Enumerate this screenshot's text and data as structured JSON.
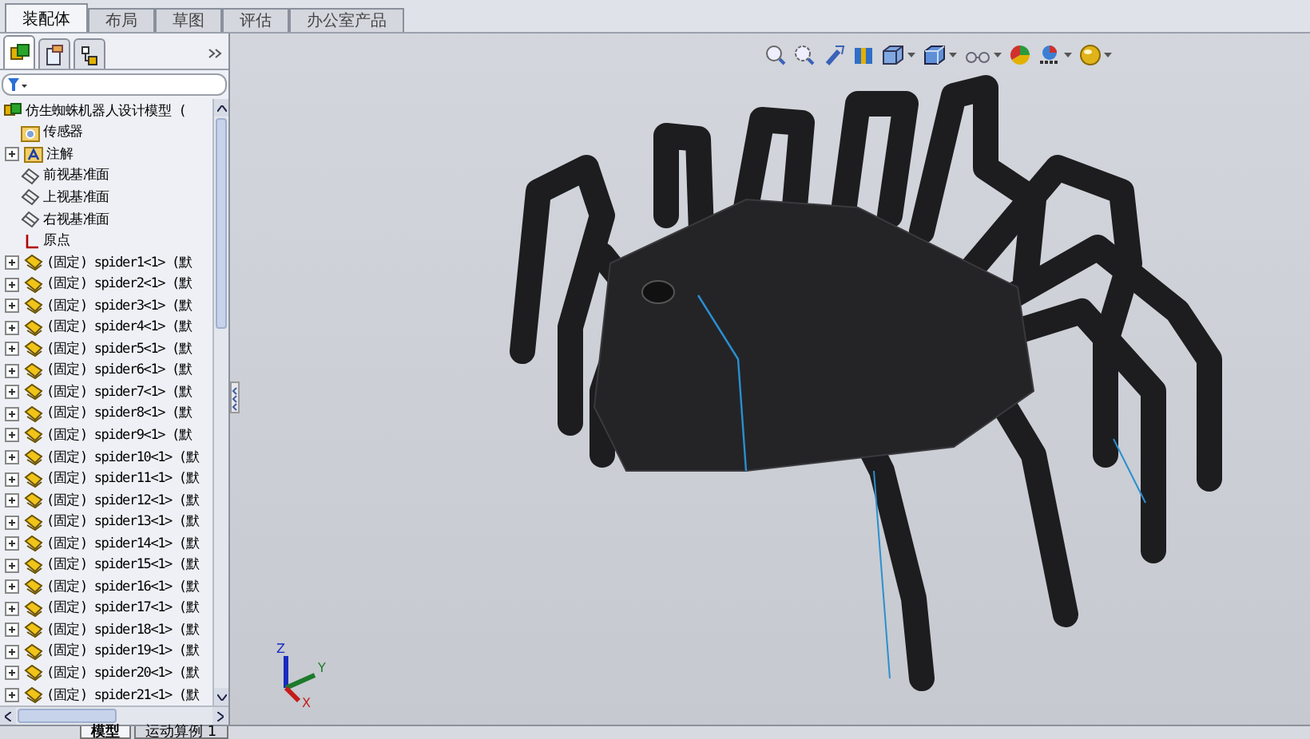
{
  "command_tabs": [
    {
      "label": "装配体",
      "selected": true
    },
    {
      "label": "布局",
      "selected": false
    },
    {
      "label": "草图",
      "selected": false
    },
    {
      "label": "评估",
      "selected": false
    },
    {
      "label": "办公室产品",
      "selected": false
    }
  ],
  "manager_tabs": [
    {
      "kind": "tree",
      "selected": true
    },
    {
      "kind": "property",
      "selected": false
    },
    {
      "kind": "config",
      "selected": false
    }
  ],
  "tree": [
    {
      "kind": "assembly",
      "label": "仿生蜘蛛机器人设计模型 ("
    },
    {
      "kind": "sensor",
      "label": "传感器"
    },
    {
      "kind": "annotation",
      "label": "注解",
      "expanded": false
    },
    {
      "kind": "plane",
      "label": "前视基准面"
    },
    {
      "kind": "plane",
      "label": "上视基准面"
    },
    {
      "kind": "plane",
      "label": "右视基准面"
    },
    {
      "kind": "origin",
      "label": "原点"
    },
    {
      "kind": "part",
      "label": "(固定) spider1<1> (默",
      "expanded": false
    },
    {
      "kind": "part",
      "label": "(固定) spider2<1> (默",
      "expanded": false
    },
    {
      "kind": "part",
      "label": "(固定) spider3<1> (默",
      "expanded": false
    },
    {
      "kind": "part",
      "label": "(固定) spider4<1> (默",
      "expanded": false
    },
    {
      "kind": "part",
      "label": "(固定) spider5<1> (默",
      "expanded": false
    },
    {
      "kind": "part",
      "label": "(固定) spider6<1> (默",
      "expanded": false
    },
    {
      "kind": "part",
      "label": "(固定) spider7<1> (默",
      "expanded": false
    },
    {
      "kind": "part",
      "label": "(固定) spider8<1> (默",
      "expanded": false
    },
    {
      "kind": "part",
      "label": "(固定) spider9<1> (默",
      "expanded": false
    },
    {
      "kind": "part",
      "label": "(固定) spider10<1> (默",
      "expanded": false
    },
    {
      "kind": "part",
      "label": "(固定) spider11<1> (默",
      "expanded": false
    },
    {
      "kind": "part",
      "label": "(固定) spider12<1> (默",
      "expanded": false
    },
    {
      "kind": "part",
      "label": "(固定) spider13<1> (默",
      "expanded": false
    },
    {
      "kind": "part",
      "label": "(固定) spider14<1> (默",
      "expanded": false
    },
    {
      "kind": "part",
      "label": "(固定) spider15<1> (默",
      "expanded": false
    },
    {
      "kind": "part",
      "label": "(固定) spider16<1> (默",
      "expanded": false
    },
    {
      "kind": "part",
      "label": "(固定) spider17<1> (默",
      "expanded": false
    },
    {
      "kind": "part",
      "label": "(固定) spider18<1> (默",
      "expanded": false
    },
    {
      "kind": "part",
      "label": "(固定) spider19<1> (默",
      "expanded": false
    },
    {
      "kind": "part",
      "label": "(固定) spider20<1> (默",
      "expanded": false
    },
    {
      "kind": "part",
      "label": "(固定) spider21<1> (默",
      "expanded": false
    }
  ],
  "bottom_tabs": [
    {
      "label": "模型",
      "selected": true
    },
    {
      "label": "运动算例 1",
      "selected": false
    }
  ],
  "triad": {
    "z": "Z",
    "y": "Y",
    "x": "X"
  }
}
